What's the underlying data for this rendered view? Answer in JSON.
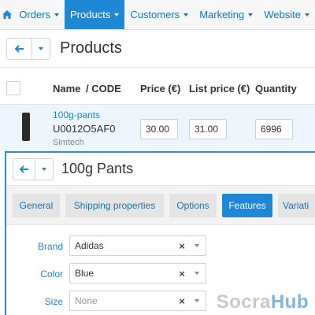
{
  "nav": {
    "items": [
      {
        "label": "Orders"
      },
      {
        "label": "Products"
      },
      {
        "label": "Customers"
      },
      {
        "label": "Marketing"
      },
      {
        "label": "Website"
      }
    ]
  },
  "page": {
    "title": "Products"
  },
  "table": {
    "headers": {
      "name": "Name",
      "code": "/ CODE",
      "price": "Price (€)",
      "list_price": "List price (€)",
      "quantity": "Quantity"
    },
    "rows": [
      {
        "name": "100g-pants",
        "code": "U0012O5AF0",
        "vendor": "Simtech",
        "price": "30.00",
        "list_price": "31.00",
        "quantity": "6996"
      }
    ]
  },
  "popup": {
    "title": "100g Pants",
    "tabs": [
      {
        "label": "General"
      },
      {
        "label": "Shipping properties"
      },
      {
        "label": "Options"
      },
      {
        "label": "Features"
      },
      {
        "label": "Variati"
      }
    ],
    "active_tab": "Features",
    "features": [
      {
        "label": "Brand",
        "value": "Adidas"
      },
      {
        "label": "Color",
        "value": "Blue"
      },
      {
        "label": "Size",
        "value": "None"
      }
    ]
  },
  "watermark": {
    "part1": "Socra",
    "part2": "Hub"
  },
  "colors": {
    "accent": "#1e87d6",
    "active_row": "#eef5fc"
  }
}
